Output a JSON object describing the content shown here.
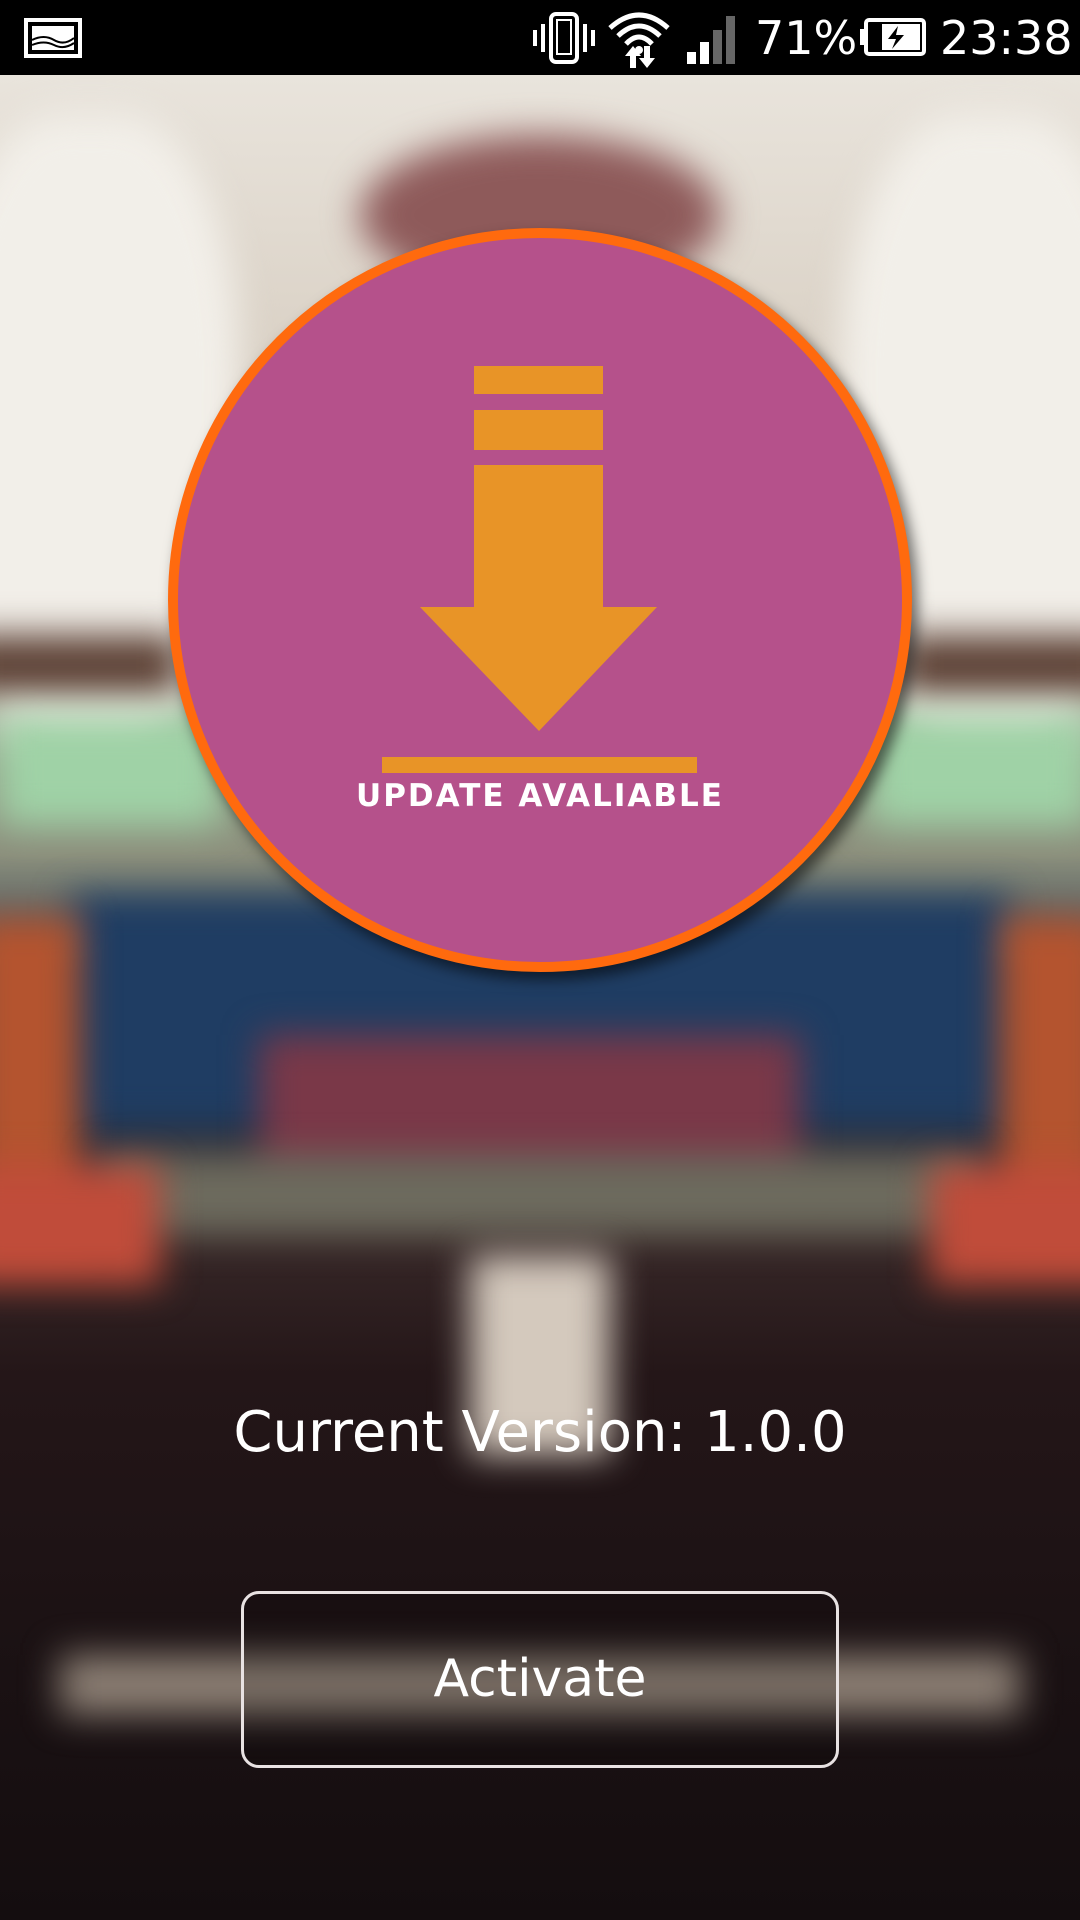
{
  "status_bar": {
    "battery_percent": "71%",
    "time": "23:38",
    "icons": [
      "screenshot-icon",
      "vibrate-icon",
      "wifi-icon",
      "signal-icon",
      "battery-charging-icon"
    ]
  },
  "update_badge": {
    "label": "UPDATE AVALIABLE",
    "icon": "download-arrow-icon",
    "fill_color": "#b5518b",
    "ring_color": "#ff6a0e",
    "icon_color": "#e89427"
  },
  "main": {
    "version_text": "Current Version: 1.0.0",
    "activate_label": "Activate"
  }
}
